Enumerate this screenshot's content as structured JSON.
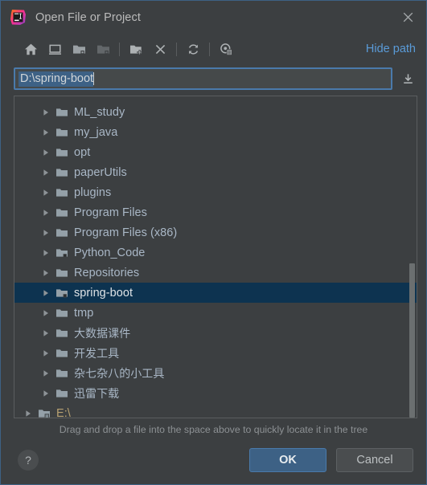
{
  "window": {
    "title": "Open File or Project",
    "logo_icon": "intellij-idea-logo",
    "close_icon": "close-icon"
  },
  "toolbar": {
    "items": [
      {
        "name": "home-icon",
        "label": "Home",
        "enabled": true
      },
      {
        "name": "desktop-icon",
        "label": "Desktop",
        "enabled": true
      },
      {
        "name": "project-folder-icon",
        "label": "Project Directory",
        "enabled": true
      },
      {
        "name": "module-folder-icon",
        "label": "Module Directory",
        "enabled": false
      },
      {
        "name": "new-folder-icon",
        "label": "New Folder",
        "enabled": true
      },
      {
        "name": "delete-icon",
        "label": "Delete",
        "enabled": true
      },
      {
        "name": "refresh-icon",
        "label": "Refresh",
        "enabled": true
      },
      {
        "name": "show-hidden-files-icon",
        "label": "Show Hidden Files and Directories",
        "enabled": true
      }
    ],
    "hide_path_label": "Hide path"
  },
  "path_field": {
    "value": "D:\\spring-boot",
    "placeholder": "",
    "selected": true,
    "download_icon": "import-path-icon"
  },
  "tree": {
    "clipped_top_row": {
      "label": "",
      "icon": "folder-icon"
    },
    "rows": [
      {
        "label": "ML_study",
        "icon": "folder-icon",
        "level": 1,
        "selected": false,
        "cjk": false
      },
      {
        "label": "my_java",
        "icon": "folder-icon",
        "level": 1,
        "selected": false,
        "cjk": false
      },
      {
        "label": "opt",
        "icon": "folder-icon",
        "level": 1,
        "selected": false,
        "cjk": false
      },
      {
        "label": "paperUtils",
        "icon": "folder-icon",
        "level": 1,
        "selected": false,
        "cjk": false
      },
      {
        "label": "plugins",
        "icon": "folder-icon",
        "level": 1,
        "selected": false,
        "cjk": false
      },
      {
        "label": "Program Files",
        "icon": "folder-icon",
        "level": 1,
        "selected": false,
        "cjk": false
      },
      {
        "label": "Program Files (x86)",
        "icon": "folder-icon",
        "level": 1,
        "selected": false,
        "cjk": false
      },
      {
        "label": "Python_Code",
        "icon": "project-folder-icon",
        "level": 1,
        "selected": false,
        "cjk": false
      },
      {
        "label": "Repositories",
        "icon": "folder-icon",
        "level": 1,
        "selected": false,
        "cjk": false
      },
      {
        "label": "spring-boot",
        "icon": "project-folder-icon",
        "level": 1,
        "selected": true,
        "cjk": false
      },
      {
        "label": "tmp",
        "icon": "folder-icon",
        "level": 1,
        "selected": false,
        "cjk": false
      },
      {
        "label": "大数据课件",
        "icon": "folder-icon",
        "level": 1,
        "selected": false,
        "cjk": true
      },
      {
        "label": "开发工具",
        "icon": "folder-icon",
        "level": 1,
        "selected": false,
        "cjk": true
      },
      {
        "label": "杂七杂八的小工具",
        "icon": "folder-icon",
        "level": 1,
        "selected": false,
        "cjk": true
      },
      {
        "label": "迅雷下载",
        "icon": "folder-icon",
        "level": 1,
        "selected": false,
        "cjk": true
      },
      {
        "label": "E:\\",
        "icon": "drive-icon",
        "level": 0,
        "selected": false,
        "cjk": false,
        "drive": true
      }
    ],
    "scrollbar": {
      "thumb_top_pct": 52,
      "thumb_height_pct": 48
    }
  },
  "hint": {
    "text": "Drag and drop a file into the space above to quickly locate it in the tree"
  },
  "footer": {
    "help_label": "?",
    "ok_label": "OK",
    "cancel_label": "Cancel"
  },
  "colors": {
    "dialog_bg": "#3c3f41",
    "accent_blue": "#4a7aab",
    "link_blue": "#5a9bd8",
    "selection_bg": "#0d3350",
    "text": "#a9b7c6",
    "ok_button": "#3d6185"
  }
}
